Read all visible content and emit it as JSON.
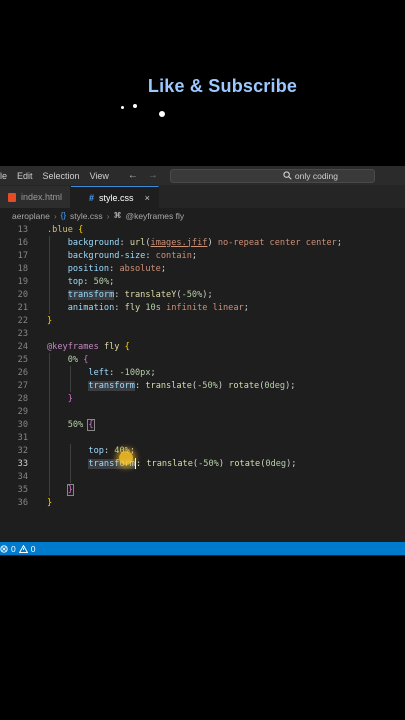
{
  "banner": {
    "title": "Like & Subscribe"
  },
  "menubar": {
    "items": [
      "ile",
      "Edit",
      "Selection",
      "View"
    ],
    "nav_back": "←",
    "nav_forward": "→",
    "search_icon": "search-icon",
    "search_text": "only coding"
  },
  "tabs": [
    {
      "label": "index.html",
      "icon": "html-file-icon",
      "active": false
    },
    {
      "label": "style.css",
      "icon": "css-file-icon",
      "active": true,
      "close": "×"
    }
  ],
  "breadcrumbs": {
    "folder": "aeroplane",
    "file": "style.css",
    "symbol": "@keyframes fly",
    "file_icon_glyph": "{}",
    "symbol_icon_glyph": "⌘"
  },
  "code": {
    "current_line": "33",
    "lines": [
      {
        "n": "13",
        "text": ".blue {"
      },
      {
        "n": "16",
        "text": "    background: url(images.jfif) no-repeat center center;"
      },
      {
        "n": "17",
        "text": "    background-size: contain;"
      },
      {
        "n": "18",
        "text": "    position: absolute;"
      },
      {
        "n": "19",
        "text": "    top: 50%;"
      },
      {
        "n": "20",
        "text": "    transform: translateY(-50%);"
      },
      {
        "n": "21",
        "text": "    animation: fly 10s infinite linear;"
      },
      {
        "n": "22",
        "text": "}"
      },
      {
        "n": "23",
        "text": ""
      },
      {
        "n": "24",
        "text": "@keyframes fly {"
      },
      {
        "n": "25",
        "text": "    0% {"
      },
      {
        "n": "26",
        "text": "        left: -100px;"
      },
      {
        "n": "27",
        "text": "        transform: translate(-50%) rotate(0deg);"
      },
      {
        "n": "28",
        "text": "    }"
      },
      {
        "n": "29",
        "text": ""
      },
      {
        "n": "30",
        "text": "    50% {"
      },
      {
        "n": "31",
        "text": ""
      },
      {
        "n": "32",
        "text": "        top: 40%;"
      },
      {
        "n": "33",
        "text": "        transform: translate(-50%) rotate(0deg);"
      },
      {
        "n": "34",
        "text": ""
      },
      {
        "n": "35",
        "text": "    }"
      },
      {
        "n": "36",
        "text": "}"
      }
    ]
  },
  "statusbar": {
    "errors": "0",
    "warnings": "0",
    "error_icon": "error-circle-icon",
    "warning_icon": "warning-triangle-icon"
  },
  "colors": {
    "accent": "#007acc",
    "banner_text": "#9cc8ff",
    "editor_bg": "#1e1e1e",
    "cursor_highlight": "#ffc828"
  }
}
